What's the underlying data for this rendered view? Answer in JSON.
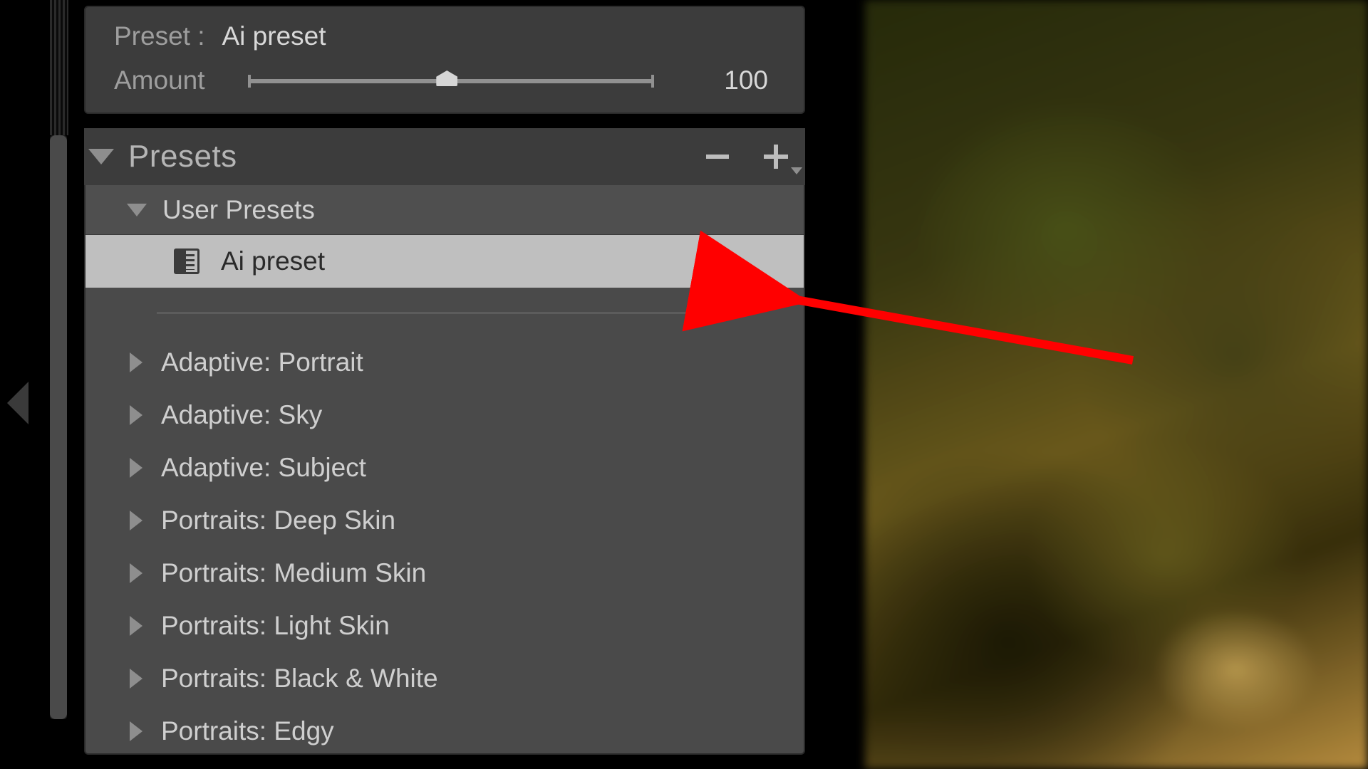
{
  "top_card": {
    "preset_label": "Preset :",
    "preset_name": "Ai preset",
    "amount_label": "Amount",
    "amount_value": "100"
  },
  "section": {
    "title": "Presets"
  },
  "user_group": {
    "label": "User Presets",
    "selected_item": "Ai preset"
  },
  "categories": [
    {
      "label": "Adaptive: Portrait"
    },
    {
      "label": "Adaptive: Sky"
    },
    {
      "label": "Adaptive: Subject"
    },
    {
      "label": "Portraits: Deep Skin"
    },
    {
      "label": "Portraits: Medium Skin"
    },
    {
      "label": "Portraits: Light Skin"
    },
    {
      "label": "Portraits: Black & White"
    },
    {
      "label": "Portraits: Edgy"
    }
  ],
  "annotation": {
    "color": "#ff0000"
  }
}
